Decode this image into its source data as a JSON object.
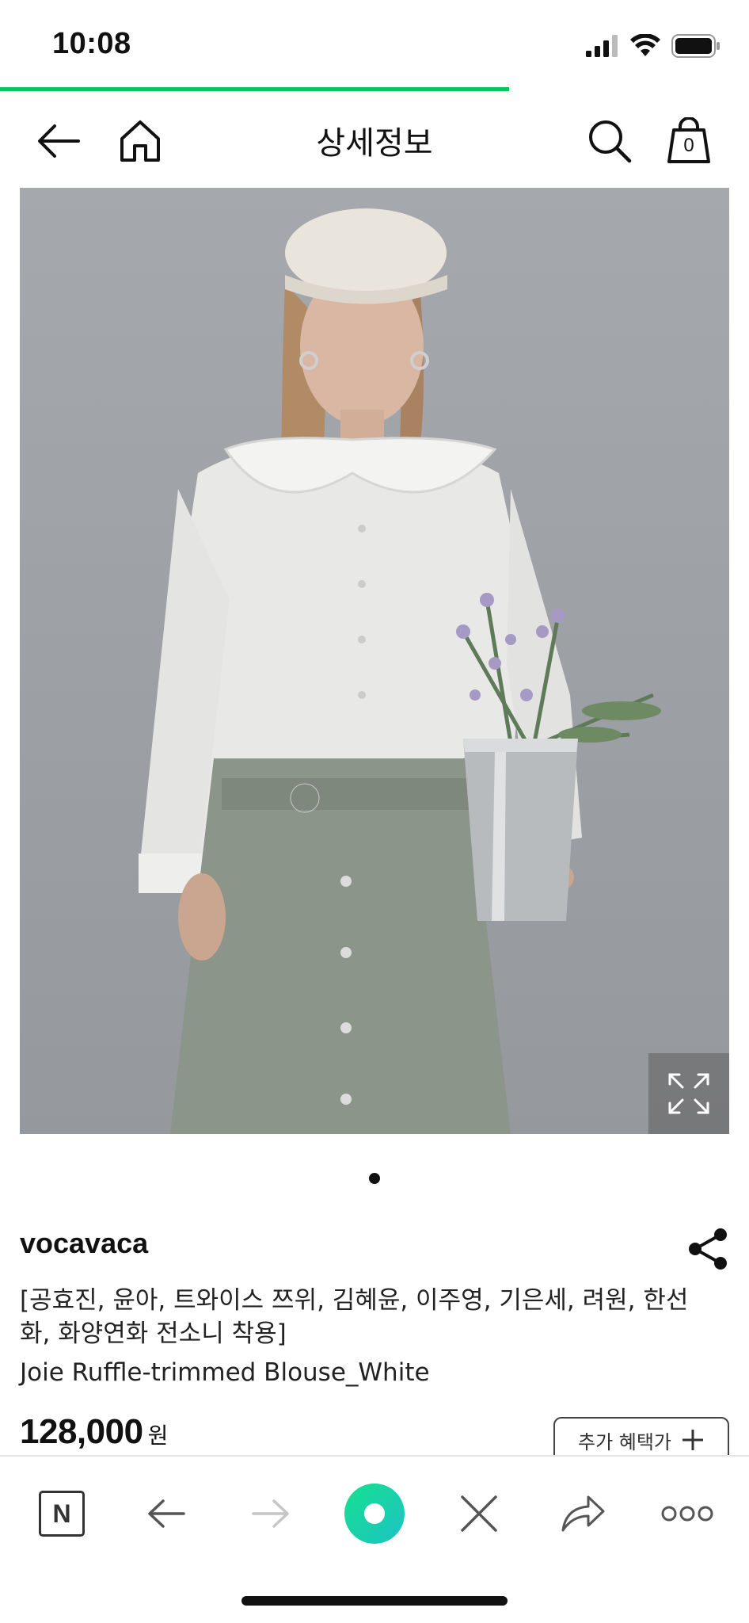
{
  "status_bar": {
    "time": "10:08",
    "icons": [
      "cellular-signal-icon",
      "wifi-icon",
      "battery-icon"
    ]
  },
  "page_load_progress": 0.68,
  "nav": {
    "title": "상세정보",
    "cart_count": "0",
    "icons": [
      "back-arrow-icon",
      "home-icon",
      "search-icon",
      "shopping-bag-icon"
    ]
  },
  "product": {
    "image_description_icon": "product-photo",
    "image_page_count": 1,
    "image_page_index": 0,
    "brand": "vocavaca",
    "title_ko": "[공효진, 윤아, 트와이스 쯔위, 김혜윤, 이주영, 기은세, 려원, 한선화, 화양연화 전소니 착용]",
    "title_en": "Joie Ruffle-trimmed Blouse_White",
    "price": "128,000",
    "price_unit": "원",
    "benefit_label": "추가 혜택가"
  },
  "toolbar": {
    "n_label": "N",
    "icons": [
      "naver-home-icon",
      "back-icon",
      "forward-icon",
      "green-dot-icon",
      "close-icon",
      "share-icon",
      "more-icon"
    ]
  },
  "colors": {
    "accent_green": "#03c75a",
    "mint_button": "#1ed6a8"
  }
}
